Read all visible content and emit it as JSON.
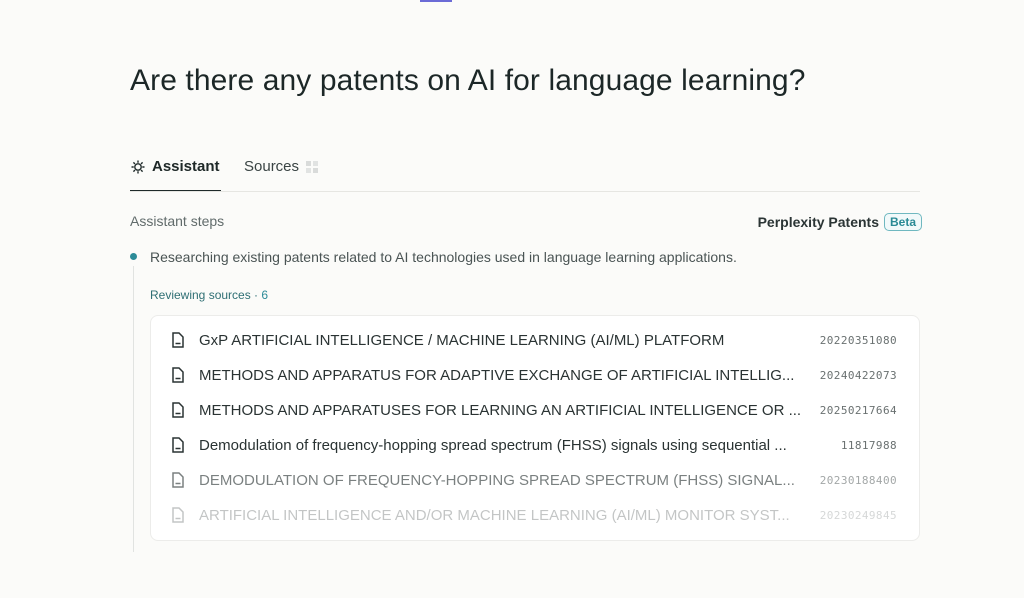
{
  "question": "Are there any patents on AI for language learning?",
  "tabs": [
    {
      "label": "Assistant",
      "icon": "assistant-icon",
      "active": true
    },
    {
      "label": "Sources",
      "icon": "source-favicons-icon",
      "active": false
    }
  ],
  "steps": {
    "label": "Assistant steps",
    "brand": "Perplexity Patents",
    "badge": "Beta",
    "step_text": "Researching existing patents related to AI technologies used in language learning applications.",
    "reviewing_label": "Reviewing sources",
    "reviewing_sep": " · ",
    "reviewing_count": "6"
  },
  "sources": [
    {
      "title": "GxP ARTIFICIAL INTELLIGENCE / MACHINE LEARNING (AI/ML) PLATFORM",
      "number": "20220351080"
    },
    {
      "title": "METHODS AND APPARATUS FOR ADAPTIVE EXCHANGE OF ARTIFICIAL INTELLIG...",
      "number": "20240422073"
    },
    {
      "title": "METHODS AND APPARATUSES FOR LEARNING AN ARTIFICIAL INTELLIGENCE OR ...",
      "number": "20250217664"
    },
    {
      "title": "Demodulation of frequency-hopping spread spectrum (FHSS) signals using sequential ...",
      "number": "11817988"
    },
    {
      "title": "DEMODULATION OF FREQUENCY-HOPPING SPREAD SPECTRUM (FHSS) SIGNAL...",
      "number": "20230188400"
    },
    {
      "title": "ARTIFICIAL INTELLIGENCE AND/OR MACHINE LEARNING (AI/ML) MONITOR SYST...",
      "number": "20230249845"
    }
  ],
  "colors": {
    "accent": "#2c8b98",
    "text": "#1f2a2a"
  }
}
